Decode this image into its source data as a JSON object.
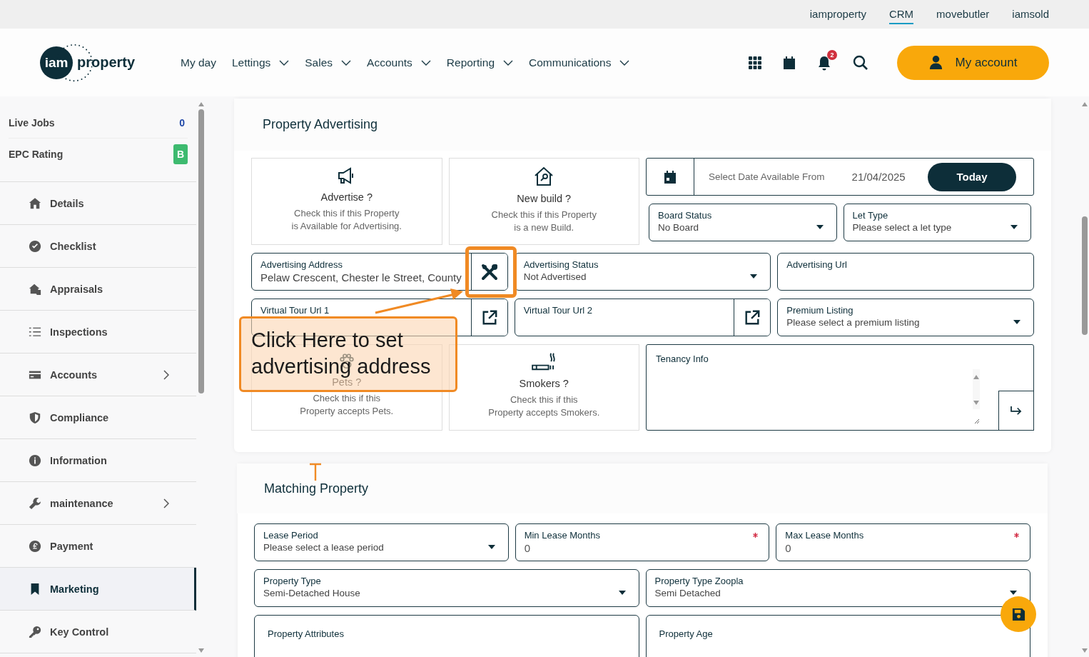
{
  "top_links": [
    {
      "label": "iamproperty",
      "selected": false
    },
    {
      "label": "CRM",
      "selected": true
    },
    {
      "label": "movebutler",
      "selected": false
    },
    {
      "label": "iamsold",
      "selected": false
    }
  ],
  "logo": {
    "badge": "iam",
    "word": "property"
  },
  "nav": [
    {
      "label": "My day",
      "dropdown": false
    },
    {
      "label": "Lettings",
      "dropdown": true
    },
    {
      "label": "Sales",
      "dropdown": true
    },
    {
      "label": "Accounts",
      "dropdown": true
    },
    {
      "label": "Reporting",
      "dropdown": true
    },
    {
      "label": "Communications",
      "dropdown": true
    }
  ],
  "notifications": {
    "count": "2"
  },
  "account_button": "My account",
  "sidebar": {
    "summary": [
      {
        "label": "Live Jobs",
        "value": "0",
        "kind": "count"
      },
      {
        "label": "EPC Rating",
        "value": "B",
        "kind": "badge",
        "color": "#3dba6f"
      }
    ],
    "items": [
      {
        "label": "Details",
        "submenu": false,
        "selected": false
      },
      {
        "label": "Checklist",
        "submenu": false,
        "selected": false
      },
      {
        "label": "Appraisals",
        "submenu": false,
        "selected": false
      },
      {
        "label": "Inspections",
        "submenu": false,
        "selected": false
      },
      {
        "label": "Accounts",
        "submenu": true,
        "selected": false
      },
      {
        "label": "Compliance",
        "submenu": false,
        "selected": false
      },
      {
        "label": "Information",
        "submenu": false,
        "selected": false
      },
      {
        "label": "maintenance",
        "submenu": true,
        "selected": false
      },
      {
        "label": "Payment",
        "submenu": false,
        "selected": false
      },
      {
        "label": "Marketing",
        "submenu": false,
        "selected": true
      },
      {
        "label": "Key Control",
        "submenu": false,
        "selected": false
      }
    ]
  },
  "advertising": {
    "title": "Property Advertising",
    "toggles_top": [
      {
        "kind": "megaphone",
        "title": "Advertise ?",
        "description": "Check this if this Property\nis Available for Advertising."
      },
      {
        "kind": "house-key",
        "title": "New build ?",
        "description": "Check this if this Property\nis a new Build."
      }
    ],
    "date": {
      "label": "Select Date Available From",
      "value": "21/04/2025",
      "button": "Today"
    },
    "selects_top": [
      {
        "kind": "select",
        "label": "Board Status",
        "value": "No Board"
      },
      {
        "kind": "select",
        "label": "Let Type",
        "value": "Please select a let type"
      }
    ],
    "fields": [
      {
        "kind": "tool",
        "label": "Advertising Address",
        "value": "Pelaw Crescent, Chester le Street, County"
      },
      {
        "kind": "select",
        "label": "Advertising Status",
        "value": "Not Advertised"
      },
      {
        "kind": "text",
        "label": "Advertising Url"
      },
      {
        "kind": "link",
        "label": "Virtual Tour Url 1"
      },
      {
        "kind": "link",
        "label": "Virtual Tour Url 2"
      },
      {
        "kind": "select",
        "label": "Premium Listing",
        "value": "Please select a premium listing"
      }
    ],
    "toggles_bottom": [
      {
        "kind": "paw",
        "title": "Pets ?",
        "description": "Check this if this\nProperty accepts Pets."
      },
      {
        "kind": "cigarette",
        "title": "Smokers ?",
        "description": "Check this if this\nProperty accepts Smokers."
      }
    ],
    "tenancy": {
      "label": "Tenancy Info"
    }
  },
  "callout": {
    "text": "Click Here to set advertising address"
  },
  "matching": {
    "title": "Matching Property",
    "row_1": [
      {
        "kind": "select",
        "label": "Lease Period",
        "value": "Please select a lease period",
        "required": false
      },
      {
        "kind": "number",
        "label": "Min Lease Months",
        "value": "0",
        "required": true
      },
      {
        "kind": "number",
        "label": "Max Lease Months",
        "value": "0",
        "required": true
      }
    ],
    "row_2": [
      {
        "kind": "select",
        "label": "Property Type",
        "value": "Semi-Detached House",
        "required": false
      },
      {
        "kind": "select",
        "label": "Property Type Zoopla",
        "value": "Semi Detached",
        "required": false
      }
    ],
    "row_3": [
      {
        "kind": "box",
        "label": "Property Attributes",
        "required": false
      },
      {
        "kind": "box",
        "label": "Property Age",
        "required": false
      }
    ]
  }
}
